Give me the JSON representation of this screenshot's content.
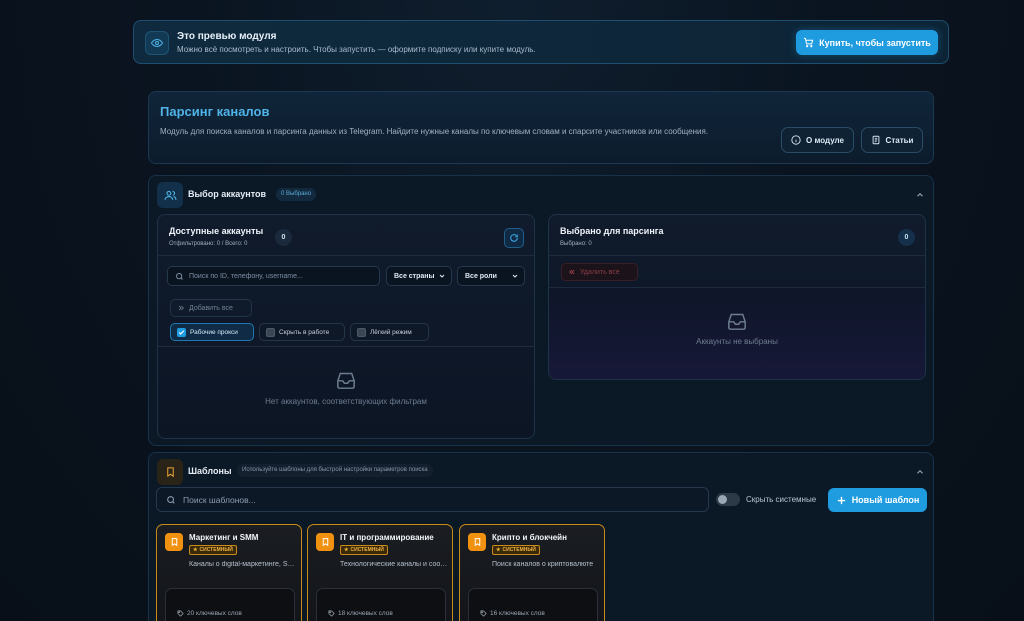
{
  "banner": {
    "title": "Это превью модуля",
    "subtitle": "Можно всё посмотреть и настроить. Чтобы запустить — оформите подписку или купите модуль.",
    "buy_label": "Купить, чтобы запустить"
  },
  "module": {
    "title": "Парсинг каналов",
    "description": "Модуль для поиска каналов и парсинга данных из Telegram. Найдите нужные каналы по ключевым словам и спарсите участников или сообщения.",
    "about_label": "О модуле",
    "articles_label": "Статьи"
  },
  "accounts": {
    "title": "Выбор аккаунтов",
    "selected_pill": "0 Выбрано",
    "available": {
      "title": "Доступные аккаунты",
      "subtitle": "Отфильтровано: 0 / Всего: 0",
      "count": "0",
      "search_placeholder": "Поиск по ID, телефону, username...",
      "country_select": "Все страны",
      "role_select": "Все роли",
      "add_all_label": "Добавить все",
      "filters": [
        {
          "label": "Рабочие прокси",
          "checked": true
        },
        {
          "label": "Скрыть в работе",
          "checked": false
        },
        {
          "label": "Лёгкий режим",
          "checked": false
        }
      ],
      "empty_text": "Нет аккаунтов, соответствующих фильтрам"
    },
    "selected": {
      "title": "Выбрано для парсинга",
      "subtitle": "Выбрано: 0",
      "count": "0",
      "remove_all_label": "Удалить все",
      "empty_text": "Аккаунты не выбраны"
    }
  },
  "templates": {
    "title": "Шаблоны",
    "hint": "Используйте шаблоны для быстрой настройки параметров поиска",
    "search_placeholder": "Поиск шаблонов...",
    "hide_system_label": "Скрыть системные",
    "hide_system_on": false,
    "new_label": "Новый шаблон",
    "cards": [
      {
        "name": "Маркетинг и SMM",
        "badge": "СИСТЕМНЫЙ",
        "description": "Каналы о digital-маркетинге, SMM, таргете",
        "keywords": "20 ключевых слов"
      },
      {
        "name": "IT и программирование",
        "badge": "СИСТЕМНЫЙ",
        "description": "Технологические каналы и сообщества",
        "keywords": "18 ключевых слов"
      },
      {
        "name": "Крипто и блокчейн",
        "badge": "СИСТЕМНЫЙ",
        "description": "Поиск каналов о криптовалюте",
        "keywords": "16 ключевых слов"
      }
    ]
  },
  "colors": {
    "accent": "#1f9be0",
    "title_blue": "#4fb3e8",
    "template_orange": "#f0910f",
    "remove_red": "#d24a4a"
  }
}
